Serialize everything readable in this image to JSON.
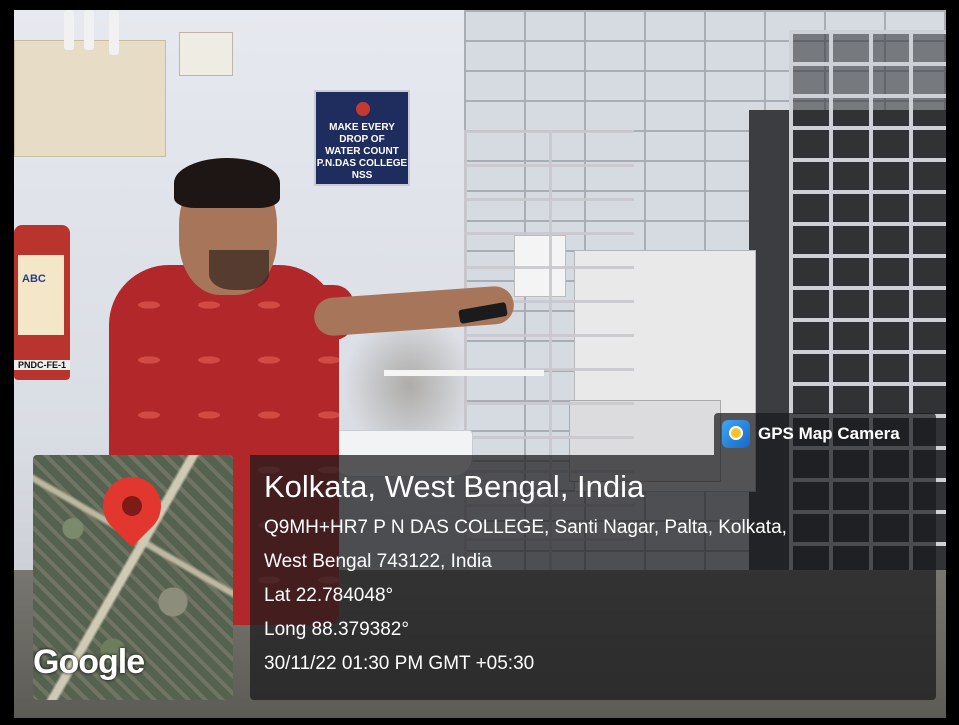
{
  "scene": {
    "sign_text": [
      "MAKE EVERY DROP OF",
      "WATER COUNT",
      "P.N.DAS COLLEGE NSS"
    ],
    "extinguisher_label": "ABC",
    "extinguisher_code": "PNDC-FE-1"
  },
  "overlay": {
    "app_name": "GPS Map Camera",
    "location_title": "Kolkata, West Bengal, India",
    "address_line_1": "Q9MH+HR7 P N DAS COLLEGE, Santi Nagar, Palta, Kolkata,",
    "address_line_2": "West Bengal 743122, India",
    "latitude": "Lat 22.784048°",
    "longitude": "Long 88.379382°",
    "timestamp": "30/11/22 01:30 PM GMT +05:30",
    "map_brand": "Google"
  },
  "colors": {
    "pin": "#e2372f",
    "panel_bg": "rgba(25,25,28,0.72)",
    "shirt": "#b2282a"
  }
}
